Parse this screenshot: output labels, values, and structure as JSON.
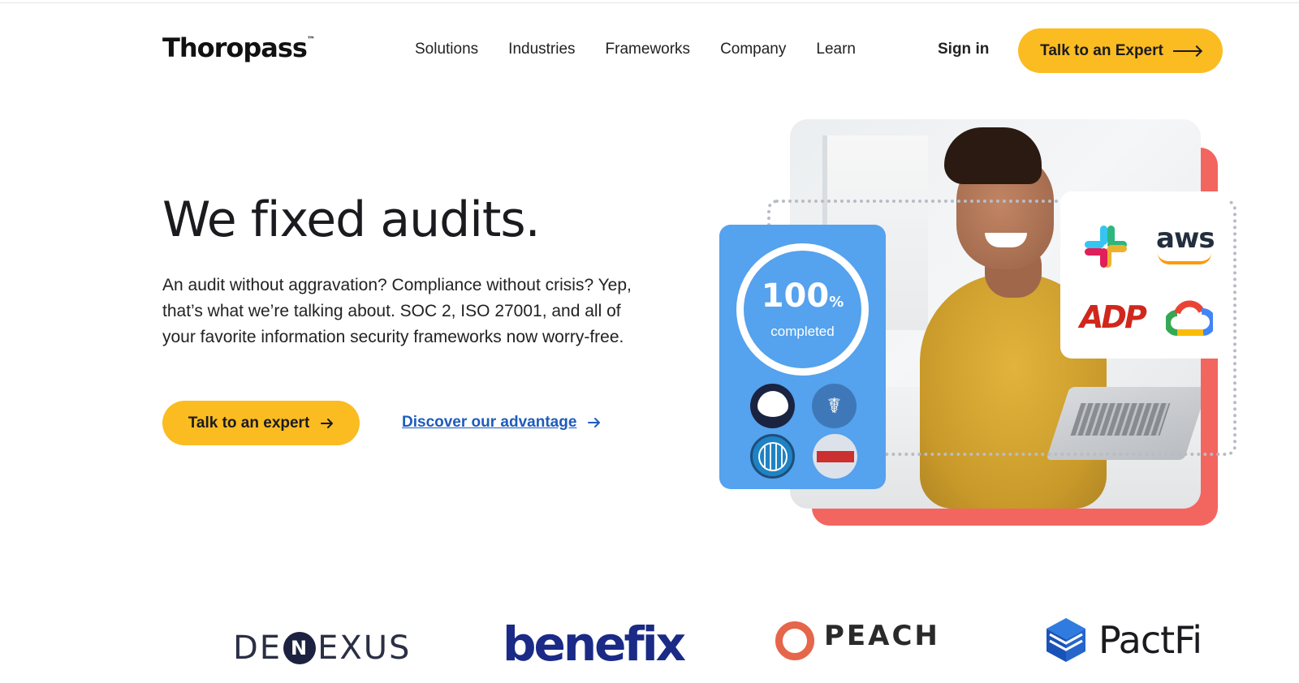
{
  "header": {
    "logo_text": "Thoropass",
    "logo_tm": "™",
    "nav": [
      "Solutions",
      "Industries",
      "Frameworks",
      "Company",
      "Learn"
    ],
    "signin_label": "Sign in",
    "cta_label": "Talk to an Expert"
  },
  "hero": {
    "title": "We fixed audits.",
    "subtitle": "An audit without aggravation? Compliance without crisis? Yep, that’s what we’re talking about. SOC 2, ISO 27001, and all of your favorite information security frameworks now worry-free.",
    "primary_cta": "Talk to an expert",
    "secondary_link": "Discover our advantage"
  },
  "progress_card": {
    "percent": "100",
    "percent_sign": "%",
    "label": "completed"
  },
  "integrations": {
    "aws": "aws",
    "adp": "ADP"
  },
  "customers": {
    "denexus_pre": "DE",
    "denexus_n": "N",
    "denexus_post": "EXUS",
    "benefix": "benefix",
    "peach": "PEACH",
    "pactfi": "PactFi"
  },
  "colors": {
    "accent_yellow": "#fbbc22",
    "link_blue": "#1e5bbd",
    "card_blue": "#55a2ee",
    "coral": "#f2665f"
  }
}
